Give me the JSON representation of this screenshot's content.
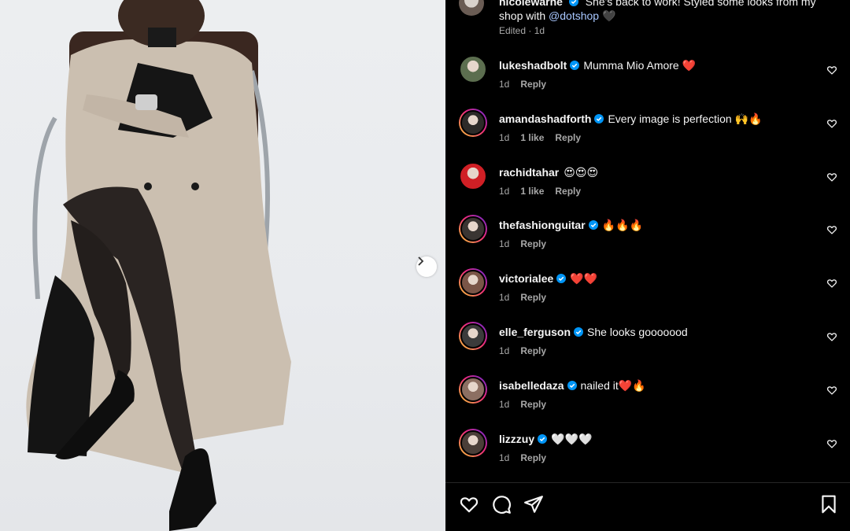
{
  "caption": {
    "username": "nicolewarne",
    "text": "She's back to work! Styled some looks from my shop with",
    "mention": "@dotshop",
    "trail": "🖤",
    "meta": "Edited · 1d"
  },
  "comments": [
    {
      "username": "lukeshadbolt",
      "verified": true,
      "text": "Mumma Mio Amore ❤️",
      "time": "1d",
      "likes": "",
      "reply": "Reply",
      "avatar_color": "#5c6e4f"
    },
    {
      "username": "amandashadforth",
      "verified": true,
      "text": "Every image is perfection 🙌🔥",
      "time": "1d",
      "likes": "1 like",
      "reply": "Reply",
      "avatar_color": "#2c2a28"
    },
    {
      "username": "rachidtahar",
      "verified": false,
      "text": "😍😍😍",
      "time": "1d",
      "likes": "1 like",
      "reply": "Reply",
      "avatar_color": "#d01f25"
    },
    {
      "username": "thefashionguitar",
      "verified": true,
      "text": "🔥🔥🔥",
      "time": "1d",
      "likes": "",
      "reply": "Reply",
      "avatar_color": "#3a3532"
    },
    {
      "username": "victorialee",
      "verified": true,
      "text": "❤️❤️",
      "time": "1d",
      "likes": "",
      "reply": "Reply",
      "avatar_color": "#7a5547"
    },
    {
      "username": "elle_ferguson",
      "verified": true,
      "text": "She looks gooooood",
      "time": "1d",
      "likes": "",
      "reply": "Reply",
      "avatar_color": "#3b3b3b"
    },
    {
      "username": "isabelledaza",
      "verified": true,
      "text": "nailed it❤️🔥",
      "time": "1d",
      "likes": "",
      "reply": "Reply",
      "avatar_color": "#8c6f62"
    },
    {
      "username": "lizzzuy",
      "verified": true,
      "text": "🤍🤍🤍",
      "time": "1d",
      "likes": "",
      "reply": "Reply",
      "avatar_color": "#4a3e38"
    }
  ],
  "icons": {
    "like": "heart-outline-icon",
    "comment": "comment-bubble-icon",
    "share": "paper-plane-icon",
    "save": "bookmark-icon",
    "carousel_next": "chevron-right-icon"
  },
  "colors": {
    "background": "#000000",
    "text": "#f5f5f5",
    "muted": "#a8a8a8",
    "verified": "#0095f6",
    "mention": "#a8c7ff"
  }
}
